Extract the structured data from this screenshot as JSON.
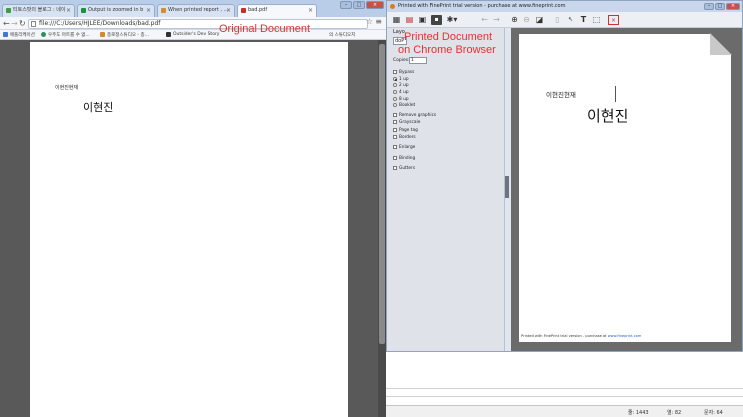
{
  "chrome": {
    "tabs": [
      {
        "label": "티토스팟의 블로그 : 네이",
        "color": "#3c9d3c"
      },
      {
        "label": "Output is zoomed in b",
        "color": "#1f8f3a"
      },
      {
        "label": "When printed report , ...",
        "color": "#d18d2e"
      },
      {
        "label": "bad.pdf",
        "color": "#cc2b2b"
      }
    ],
    "url": "file:///C:/Users/HJLEE/Downloads/bad.pdf",
    "bookmarks": [
      {
        "label": "애플리케이션",
        "color": "#3b79d4"
      },
      {
        "label": "우주도 마트를 수 없...",
        "color": "#2f8f5a"
      },
      {
        "label": "종로정스튜디오 - 종...",
        "color": "#d48a2b"
      },
      {
        "label": "Outsider's Dev Story",
        "color": "#333333"
      },
      {
        "label": "의 스튜디오지",
        "color": "#777777"
      }
    ]
  },
  "left_page": {
    "header_text": "이현진현재",
    "name_text": "이현진"
  },
  "annotations": {
    "original": "Original Document",
    "printed_line1": "Printed Document",
    "printed_line2": "on Chrome Browser"
  },
  "fineprint": {
    "title": "Printed with FinePrint trial version - purchase at www.fineprint.com",
    "layout_label": "Layo",
    "layout_value": "doP",
    "copies_label": "Copies:",
    "copies_value": "1",
    "options": [
      {
        "label": "Bypass",
        "kind": "check",
        "on": false
      },
      {
        "label": "1 up",
        "kind": "radio",
        "on": true
      },
      {
        "label": "2 up",
        "kind": "radio",
        "on": false
      },
      {
        "label": "4 up",
        "kind": "radio",
        "on": false
      },
      {
        "label": "8 up",
        "kind": "radio",
        "on": false
      },
      {
        "label": "Booklet",
        "kind": "radio",
        "on": false
      },
      {
        "label": "Remove graphics",
        "kind": "check",
        "on": false
      },
      {
        "label": "Grayscale",
        "kind": "check",
        "on": false
      },
      {
        "label": "Page tag",
        "kind": "check",
        "on": false
      },
      {
        "label": "Borders",
        "kind": "check",
        "on": false
      },
      {
        "label": "Enlarge",
        "kind": "check",
        "on": false
      },
      {
        "label": "Binding",
        "kind": "check",
        "on": false
      },
      {
        "label": "Gutters",
        "kind": "check",
        "on": false
      }
    ],
    "page_header": "이현진현재",
    "page_name": "이현진",
    "footer_text": "Printed with FinePrint trial version - purchase at ",
    "footer_link": "www.fineprint.com"
  },
  "status": {
    "lines": "줄: 1443",
    "col": "열: 82",
    "chars": "문자: 64"
  },
  "colors": {
    "annotation_red": "#e5322d",
    "viewer_bg": "#595959",
    "link_blue": "#2456c9"
  }
}
